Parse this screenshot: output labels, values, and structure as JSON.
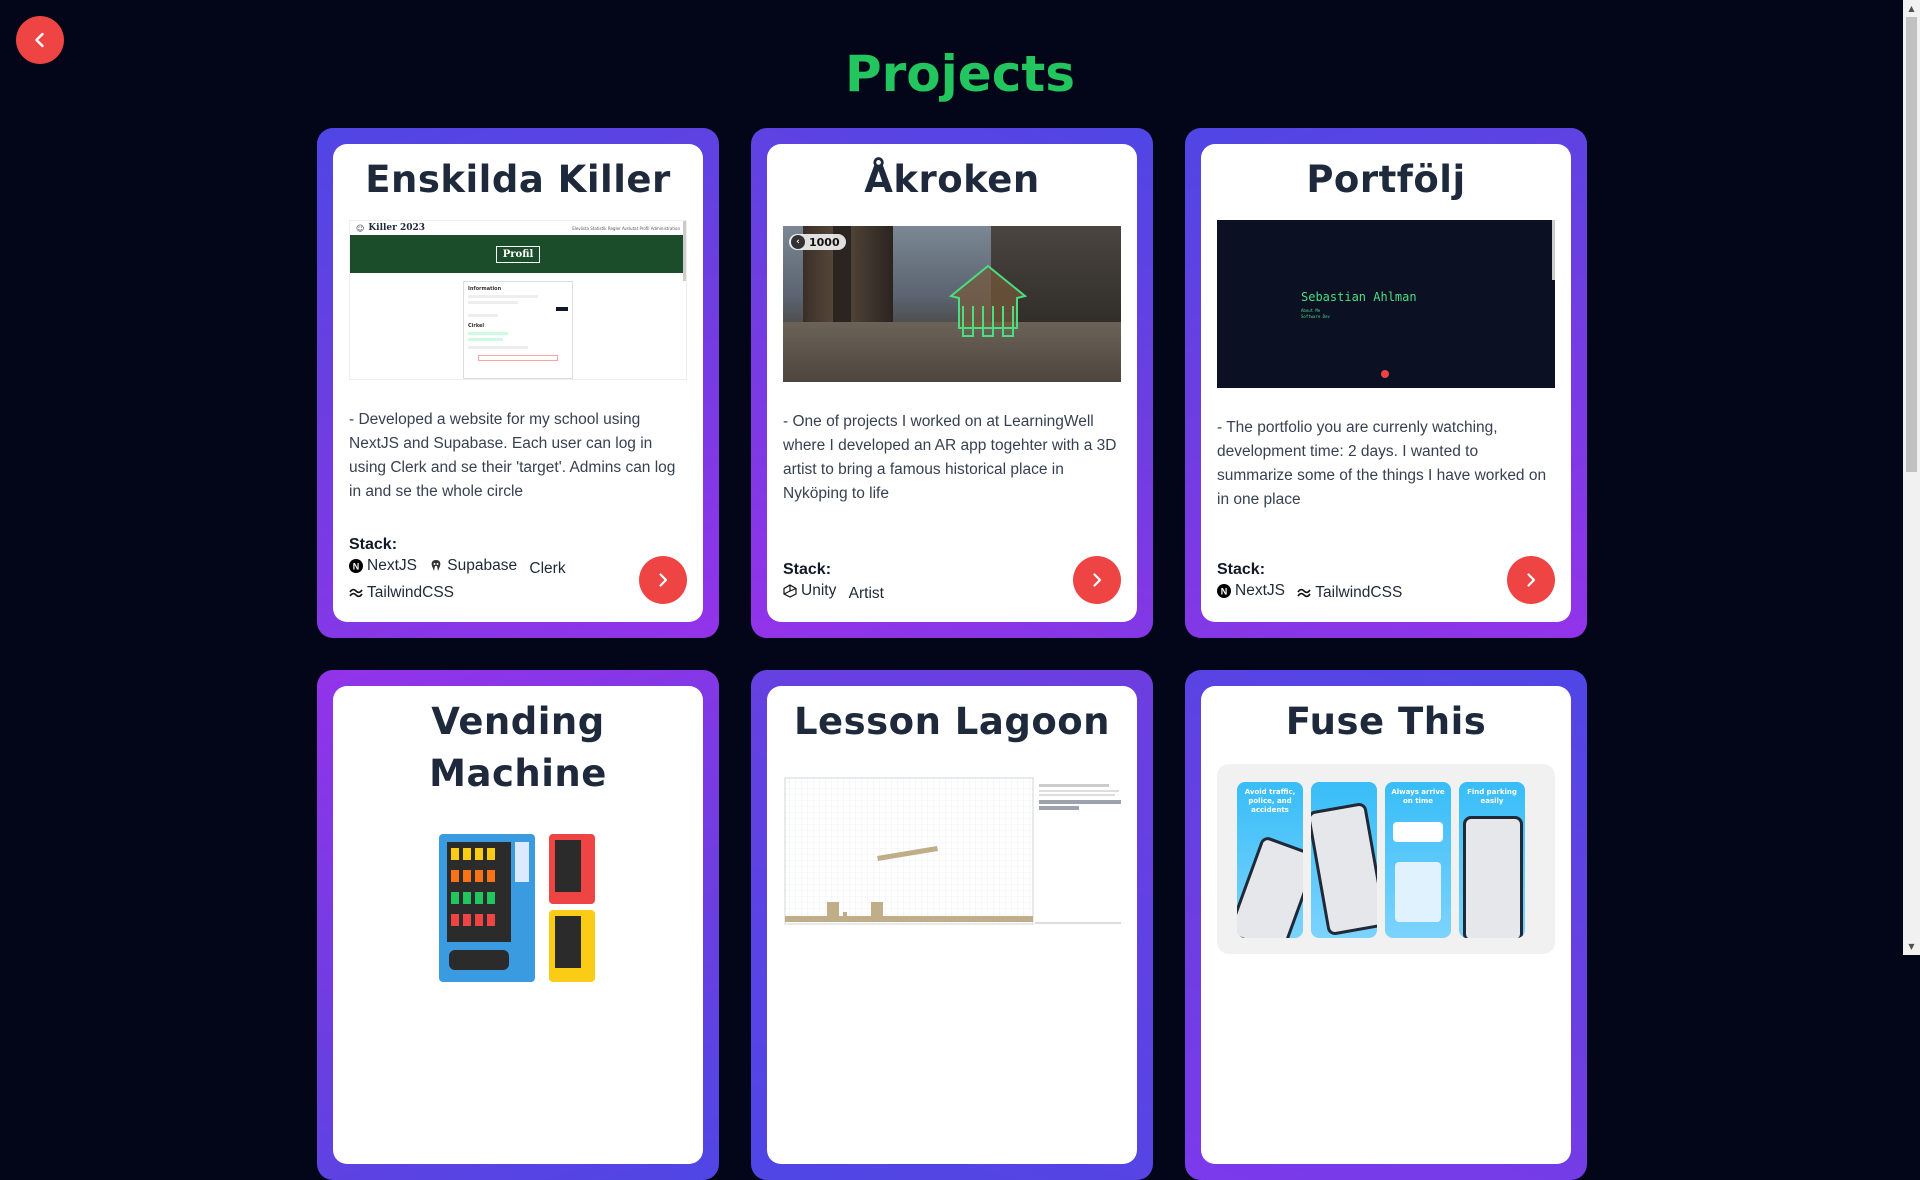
{
  "page": {
    "title": "Projects"
  },
  "colors": {
    "accent": "#ef4444",
    "title": "#22c55e",
    "background": "#030619"
  },
  "projects": [
    {
      "title": "Enskilda Killer",
      "preview": {
        "site_name": "Killer 2023",
        "nav": [
          "Elevlista",
          "Statistik",
          "Regler",
          "Avslutat",
          "Profil",
          "Administration"
        ],
        "banner": "Profil",
        "section_a": "Information",
        "section_b": "Cirkel"
      },
      "description": "- Developed a website for my school using NextJS and Supabase. Each user can log in using Clerk and se their 'target'. Admins can log in and se the whole circle",
      "stack_label": "Stack:",
      "stack": [
        {
          "name": "NextJS",
          "icon": "nextjs-icon"
        },
        {
          "name": "Supabase",
          "icon": "supabase-icon"
        },
        {
          "name": "Clerk",
          "icon": ""
        },
        {
          "name": "TailwindCSS",
          "icon": "tailwind-icon"
        }
      ]
    },
    {
      "title": "Åkroken",
      "preview": {
        "counter": "1000"
      },
      "description": "- One of projects I worked on at LearningWell where I developed an AR app togehter with a 3D artist to bring a famous historical place in Nyköping to life",
      "stack_label": "Stack:",
      "stack": [
        {
          "name": "Unity",
          "icon": "unity-icon"
        },
        {
          "name": "Artist",
          "icon": ""
        }
      ]
    },
    {
      "title": "Portfölj",
      "preview": {
        "name": "Sebastian Ahlman",
        "line1": "About Me",
        "line2": "Software Dev"
      },
      "description": "- The portfolio you are currenly watching, development time: 2 days. I wanted to summarize some of the things I have worked on in one place",
      "stack_label": "Stack:",
      "stack": [
        {
          "name": "NextJS",
          "icon": "nextjs-icon"
        },
        {
          "name": "TailwindCSS",
          "icon": "tailwind-icon"
        }
      ]
    },
    {
      "title": "Vending Machine"
    },
    {
      "title": "Lesson Lagoon"
    },
    {
      "title": "Fuse This",
      "preview": {
        "screens": [
          "Avoid traffic, police, and accidents",
          "",
          "Always arrive on time",
          "Find parking easily"
        ]
      }
    }
  ]
}
